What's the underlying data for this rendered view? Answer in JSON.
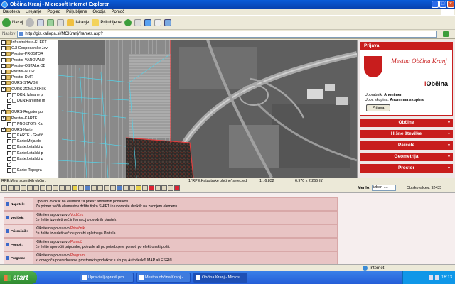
{
  "window": {
    "title": "Občina Kranj - Microsoft Internet Explorer"
  },
  "menu": [
    "Datoteka",
    "Urejanje",
    "Pogled",
    "Priljubljene",
    "Orodja",
    "Pomoč"
  ],
  "toolbar": {
    "back_label": "Nazaj",
    "search_label": "Iskanje",
    "favorites_label": "Priljubljene"
  },
  "address": {
    "label": "Naslov",
    "url": "http://gis.kaliopa.si/MOKranj/frames.asp?",
    "go_label": "Pojdi"
  },
  "layers": [
    {
      "label": "Infrastruktura-ELEKT",
      "checked": false,
      "indent": 0,
      "icon": "folder"
    },
    {
      "label": "GJI Gospodarske Jav",
      "checked": false,
      "indent": 0,
      "icon": "folder"
    },
    {
      "label": "Prostor-PROSTOR",
      "checked": false,
      "indent": 0,
      "icon": "folder"
    },
    {
      "label": "Prostor-VAROVANJ",
      "checked": false,
      "indent": 0,
      "icon": "folder"
    },
    {
      "label": "Prostor-OSTALA OB",
      "checked": false,
      "indent": 0,
      "icon": "folder"
    },
    {
      "label": "Prostor-NUSZ",
      "checked": false,
      "indent": 0,
      "icon": "folder"
    },
    {
      "label": "Prostor-DMR",
      "checked": false,
      "indent": 0,
      "icon": "folder"
    },
    {
      "label": "GURS-STAVBE",
      "checked": false,
      "indent": 0,
      "icon": "folder"
    },
    {
      "label": "GURS-ZEMLJIŠKI K",
      "checked": true,
      "indent": 0,
      "icon": "folder"
    },
    {
      "label": "DKN: Izbrane p",
      "checked": false,
      "indent": 1,
      "icon": "layer"
    },
    {
      "label": "DKN:Parcelne m",
      "checked": true,
      "indent": 1,
      "icon": "layer"
    },
    {
      "label": "",
      "checked": false,
      "indent": 1,
      "icon": "none"
    },
    {
      "label": "GURS-Register po",
      "checked": true,
      "indent": 0,
      "icon": "folder"
    },
    {
      "label": "Prostor-KARTE",
      "checked": true,
      "indent": 0,
      "icon": "folder"
    },
    {
      "label": "PROSTOR: Ka",
      "checked": false,
      "indent": 1,
      "icon": "layer"
    },
    {
      "label": "GURS-Karte",
      "checked": true,
      "indent": 0,
      "icon": "folder"
    },
    {
      "label": "KARTE - Grafič",
      "checked": false,
      "indent": 1,
      "icon": "layer"
    },
    {
      "label": "Karte:Meja ob",
      "checked": false,
      "indent": 1,
      "icon": "layer"
    },
    {
      "label": "Karte:Letalski p",
      "checked": false,
      "indent": 1,
      "icon": "layer"
    },
    {
      "label": "Karte:Letalski p",
      "checked": false,
      "indent": 1,
      "icon": "layer"
    },
    {
      "label": "Karte:Letalski p",
      "checked": true,
      "indent": 1,
      "icon": "layer"
    },
    {
      "label": "",
      "checked": true,
      "indent": 1,
      "icon": "none"
    },
    {
      "label": "Karte: Topogra",
      "checked": false,
      "indent": 1,
      "icon": "layer"
    }
  ],
  "right_panel": {
    "login_header": "Prijava",
    "city_name": "Mestna Občina Kranj",
    "brand_prefix": "i",
    "brand_rest": "Občina",
    "user_label": "Uporabnik:",
    "user_value": "Anonimen",
    "group_label": "Upor. skupina:",
    "group_value": "Anonimna skupina",
    "login_button": "Prijava",
    "sections": [
      "Občine",
      "Hišne številke",
      "Parcele",
      "Geometrija",
      "Prostor"
    ]
  },
  "map_status": {
    "layer_info": "RPE:Meja soseških občin :",
    "selected": "1 'RPE:Katastrske občine' selected",
    "scale": "1 : 6.832",
    "size": "6.970 x 2.266 (ft)"
  },
  "scale_control": {
    "label": "Merilo:",
    "value": "izberi ....",
    "visits": "Obiskovalcev: 92435"
  },
  "help": [
    {
      "title": "Napotek:",
      "line1": "Uporabi dvoklik na element za prikaz atributnih podatkov.",
      "line1_em": "",
      "line2": "Za primer večih elementov držite tipko SHIFT in uporabite dvoklik na zadnjem elementu."
    },
    {
      "title": "Vodiček:",
      "line1": "Kliknite na povezavo",
      "line1_em": "Vodiček",
      "line2": "če želite izvedeti več informacij o uvodnih plasteh."
    },
    {
      "title": "Prisročnik:",
      "line1": "Kliknite na povezavo",
      "line1_em": "Priročnik",
      "line2": "če želite izvedeti več o uporabi spletnega Portala."
    },
    {
      "title": "Pomoč:",
      "line1": "Kliknite na povezavo",
      "line1_em": "Pomoč",
      "line2": "če želite sporočiti pripombe, pohvale ali po potrebujete pomoč po elektronski pošti."
    },
    {
      "title": "Program:",
      "line1": "Kliknite na povezavo",
      "line1_em": "Program",
      "line2": "ki omogoča posredovanje prostorskih podatkov s skupaj Autodesk® MAP ali ESRI®."
    }
  ],
  "browser_status": {
    "zone": "Internet"
  },
  "taskbar": {
    "start": "start",
    "tasks": [
      "Upravitelj opravil pro...",
      "Mestna občina Kranj -...",
      "Občina Kranj - Micros..."
    ],
    "clock": "16:13"
  }
}
